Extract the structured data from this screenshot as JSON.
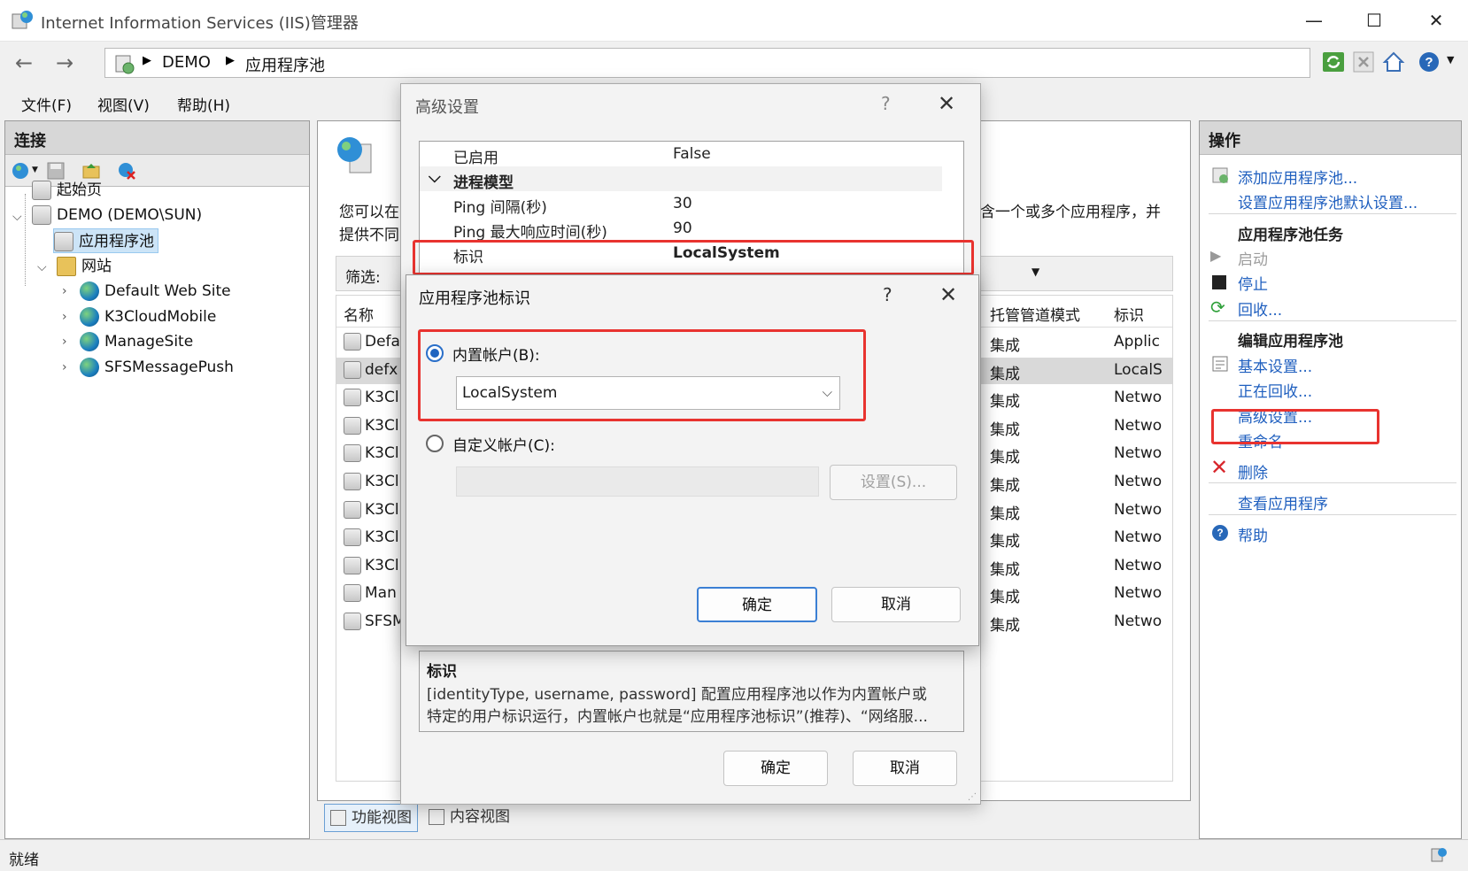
{
  "window": {
    "title": "Internet Information Services (IIS)管理器",
    "minimize": "—",
    "maximize": "☐",
    "close": "✕"
  },
  "address": {
    "back": "←",
    "forward": "→",
    "crumbs": [
      "DEMO",
      "应用程序池"
    ]
  },
  "menu": [
    "文件(F)",
    "视图(V)",
    "帮助(H)"
  ],
  "left": {
    "header": "连接",
    "tree": [
      {
        "label": "起始页"
      },
      {
        "label": "DEMO (DEMO\\SUN)"
      },
      {
        "label": "应用程序池"
      },
      {
        "label": "网站"
      },
      {
        "label": "Default Web Site"
      },
      {
        "label": "K3CloudMobile"
      },
      {
        "label": "ManageSite"
      },
      {
        "label": "SFSMessagePush"
      }
    ]
  },
  "center": {
    "intro_line1": "您可以在",
    "intro_line2": "提供不同",
    "intro_right": "含一个或多个应用程序，并",
    "filter_label": "筛选:",
    "columns": {
      "name": "名称",
      "pipeline": "托管管道模式",
      "identity": "标识"
    },
    "rows": [
      {
        "name": "Defa",
        "pipeline": "集成",
        "identity": "Applic"
      },
      {
        "name": "defx",
        "pipeline": "集成",
        "identity": "LocalS"
      },
      {
        "name": "K3Cl",
        "pipeline": "集成",
        "identity": "Netwo"
      },
      {
        "name": "K3Cl",
        "pipeline": "集成",
        "identity": "Netwo"
      },
      {
        "name": "K3Cl",
        "pipeline": "集成",
        "identity": "Netwo"
      },
      {
        "name": "K3Cl",
        "pipeline": "集成",
        "identity": "Netwo"
      },
      {
        "name": "K3Cl",
        "pipeline": "集成",
        "identity": "Netwo"
      },
      {
        "name": "K3Cl",
        "pipeline": "集成",
        "identity": "Netwo"
      },
      {
        "name": "K3Cl",
        "pipeline": "集成",
        "identity": "Netwo"
      },
      {
        "name": "Man",
        "pipeline": "集成",
        "identity": "Netwo"
      },
      {
        "name": "SFSM",
        "pipeline": "集成",
        "identity": "Netwo"
      }
    ],
    "tabs": [
      "功能视图",
      "内容视图"
    ]
  },
  "right": {
    "header": "操作",
    "add_pool": "添加应用程序池...",
    "pool_defaults": "设置应用程序池默认设置...",
    "tasks_head": "应用程序池任务",
    "start": "启动",
    "stop": "停止",
    "recycle": "回收...",
    "edit_head": "编辑应用程序池",
    "basic": "基本设置...",
    "recycling": "正在回收...",
    "advanced": "高级设置...",
    "rename": "重命名",
    "delete": "删除",
    "view_apps": "查看应用程序",
    "help": "帮助"
  },
  "status": "就绪",
  "adv": {
    "title": "高级设置",
    "help": "?",
    "close": "✕",
    "props": [
      {
        "k": "已启用",
        "v": "False"
      },
      {
        "k": "进程模型",
        "v": ""
      },
      {
        "k": "Ping 间隔(秒)",
        "v": "30"
      },
      {
        "k": "Ping 最大响应时间(秒)",
        "v": "90"
      },
      {
        "k": "标识",
        "v": "LocalSystem"
      }
    ],
    "desc_head": "标识",
    "desc_line1": "[identityType, username, password] 配置应用程序池以作为内置帐户或",
    "desc_line2": "特定的用户标识运行，内置帐户也就是“应用程序池标识”(推荐)、“网络服...",
    "ok": "确定",
    "cancel": "取消"
  },
  "identity": {
    "title": "应用程序池标识",
    "help": "?",
    "close": "✕",
    "builtin_label": "内置帐户(B):",
    "builtin_value": "LocalSystem",
    "custom_label": "自定义帐户(C):",
    "set_button": "设置(S)...",
    "ok": "确定",
    "cancel": "取消"
  },
  "colors": {
    "highlight": "#e8332f",
    "link": "#1f5fbf"
  }
}
